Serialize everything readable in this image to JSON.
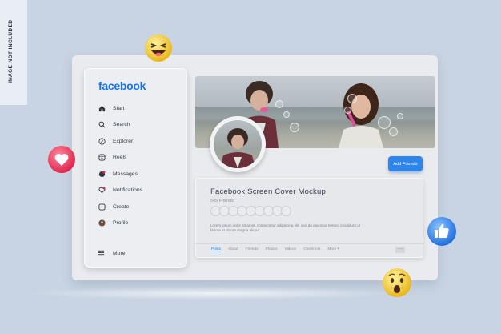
{
  "side_label": "IMAGE NOT INCLUDED",
  "sidebar": {
    "logo": "facebook",
    "items": [
      {
        "label": "Start",
        "icon": "home-icon"
      },
      {
        "label": "Search",
        "icon": "search-icon"
      },
      {
        "label": "Explorer",
        "icon": "compass-icon"
      },
      {
        "label": "Reels",
        "icon": "reels-icon"
      },
      {
        "label": "Messages",
        "icon": "messages-icon"
      },
      {
        "label": "Notifications",
        "icon": "heart-icon"
      },
      {
        "label": "Create",
        "icon": "plus-icon"
      },
      {
        "label": "Profile",
        "icon": "profile-avatar-icon"
      }
    ],
    "more_label": "More"
  },
  "profile": {
    "add_friends_label": "Add Friends",
    "title": "Facebook Screen Cover Mockup",
    "friends_count": "545 Friends",
    "description": "Lorem ipsum dolor sit amet, consectetur adipiscing elit, sed do eiusmod tempor incididunt ut labore et dolore magna aliqua.",
    "tabs": [
      "Posts",
      "About",
      "Friends",
      "Photos",
      "Videos",
      "Check-ins",
      "More ▾"
    ],
    "dots_label": "···"
  },
  "colors": {
    "accent": "#2d86ee",
    "logo": "#1773ea",
    "background": "#c8d4e3"
  },
  "emojis": [
    "laughing-emoji",
    "heart-reaction",
    "like-reaction",
    "surprised-emoji"
  ]
}
